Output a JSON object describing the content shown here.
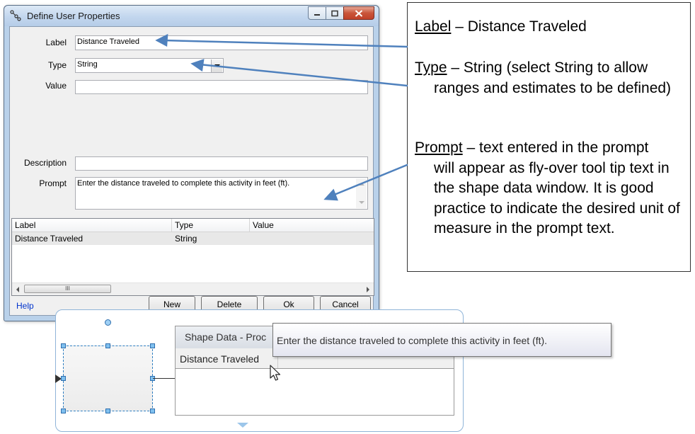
{
  "dialog": {
    "title": "Define User Properties",
    "fields": {
      "label_caption": "Label",
      "label_value": "Distance Traveled",
      "type_caption": "Type",
      "type_value": "String",
      "value_caption": "Value",
      "value_value": "",
      "description_caption": "Description",
      "description_value": "",
      "prompt_caption": "Prompt",
      "prompt_value": "Enter the distance traveled to complete this activity in feet (ft)."
    },
    "list": {
      "columns": [
        "Label",
        "Type",
        "Value"
      ],
      "rows": [
        {
          "label": "Distance Traveled",
          "type": "String",
          "value": ""
        }
      ],
      "scroll_thumb": "III"
    },
    "help_link": "Help",
    "buttons": {
      "new": "New",
      "delete": "Delete",
      "ok": "Ok",
      "cancel": "Cancel"
    }
  },
  "callout": {
    "label_term": "Label",
    "label_desc": " – Distance Traveled",
    "type_term": "Type",
    "type_desc_1": " – String (select String to allow",
    "type_desc_2": "ranges and estimates to be defined)",
    "prompt_term": "Prompt",
    "prompt_desc_1": " – text entered in the prompt",
    "prompt_desc_2": "will appear as fly-over tool tip text in the shape data window.  It is good practice to indicate the desired unit of measure in the prompt text."
  },
  "shape_data_window": {
    "title": "Shape Data - Proc",
    "row_label": "Distance Traveled"
  },
  "tooltip": {
    "text": "Enter the distance traveled to complete this activity in feet (ft)."
  },
  "colors": {
    "dialog_frame": "#b9d1ea",
    "callout_arrow": "#4f81bd",
    "close_button": "#c9553a",
    "selection_handle": "#7fc0ef"
  }
}
